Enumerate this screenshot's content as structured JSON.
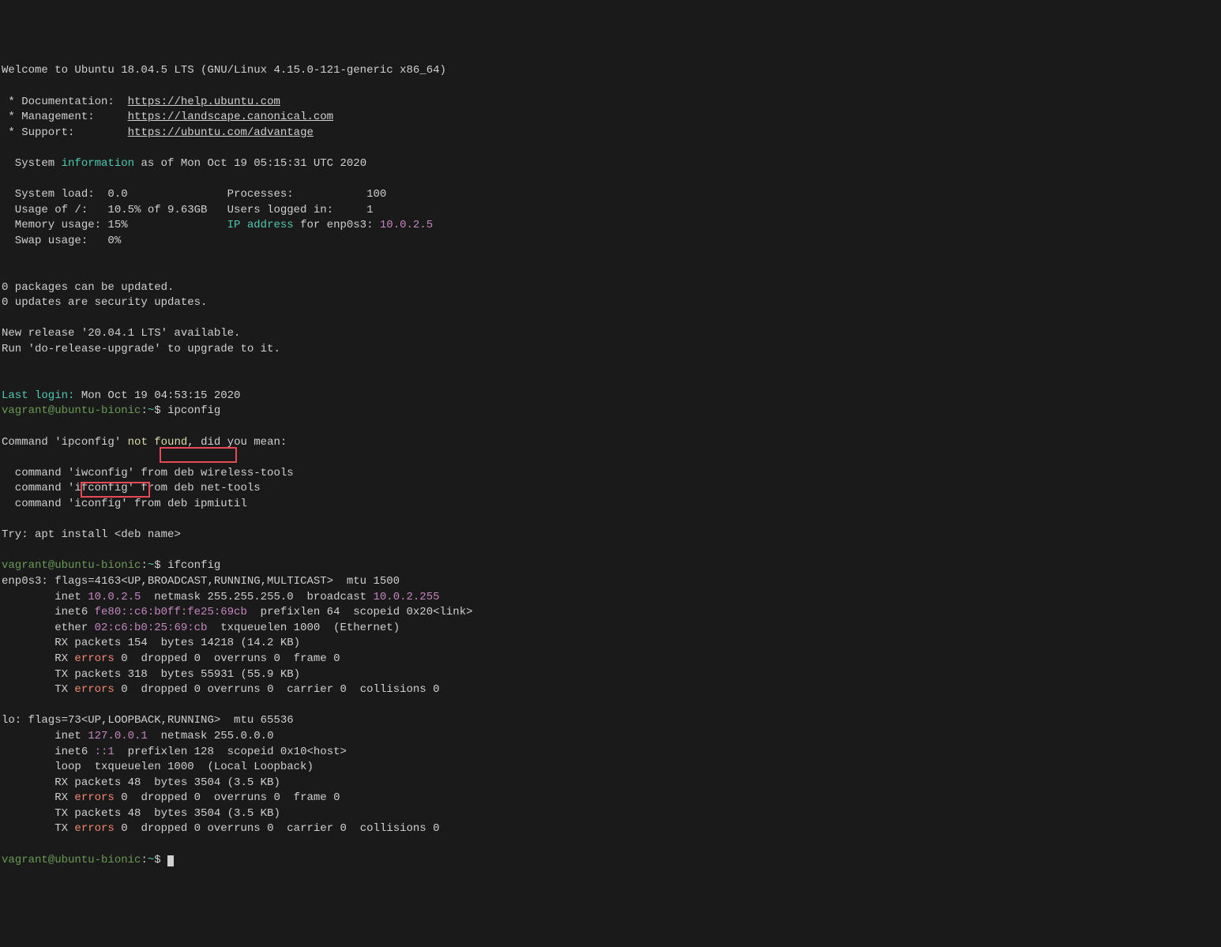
{
  "welcome": "Welcome to Ubuntu 18.04.5 LTS (GNU/Linux 4.15.0-121-generic x86_64)",
  "doc_label": " * Documentation:  ",
  "doc_url": "https://help.ubuntu.com",
  "mgmt_label": " * Management:     ",
  "mgmt_url": "https://landscape.canonical.com",
  "support_label": " * Support:        ",
  "support_url": "https://ubuntu.com/advantage",
  "sysinfo_prefix": "  System ",
  "sysinfo_info": "information",
  "sysinfo_suffix": " as of Mon Oct 19 05:15:31 UTC 2020",
  "sysload": "  System load:  0.0               Processes:           100",
  "usage": "  Usage of /:   10.5% of 9.63GB   Users logged in:     1",
  "memory_prefix": "  Memory usage: 15%               ",
  "ip_label": "IP address",
  "ip_for": " for enp0s3: ",
  "ip_value": "10.0.2.5",
  "swap": "  Swap usage:   0%",
  "packages": "0 packages can be updated.",
  "updates": "0 updates are security updates.",
  "release1": "New release '20.04.1 LTS' available.",
  "release2": "Run 'do-release-upgrade' to upgrade to it.",
  "lastlogin_label": "Last login:",
  "lastlogin_value": " Mon Oct 19 04:53:15 2020",
  "prompt1_user": "vagrant@ubuntu-bionic",
  "prompt1_colon": ":",
  "prompt1_path": "~",
  "prompt1_dollar": "$ ",
  "cmd_ipconfig": "ipconfig",
  "err_prefix": "Command 'ipconfig' ",
  "err_notfound": "not found",
  "err_suffix": ", did you mean:",
  "suggest1": "  command 'iwconfig' from deb wireless-tools",
  "suggest2": "  command 'ifconfig' from deb net-tools",
  "suggest3": "  command 'iconfig' from deb ipmiutil",
  "try_prefix": "Try: apt install ",
  "try_deb": "<deb name>",
  "cmd_ifconfig": "ifconfig",
  "if1_line1_a": "enp0s3: flags=4163<UP,BROADCAST,RUNNING,MULTICAST>  mtu 1500",
  "if1_line2_a": "        inet ",
  "if1_inet": "10.0.2.5",
  "if1_line2_b": "  netmask 255.255.255.0  broadcast ",
  "if1_bcast": "10.0.2.255",
  "if1_line3_a": "        inet6 ",
  "if1_inet6": "fe80::c6:b0ff:fe25:69cb",
  "if1_line3_b": "  prefixlen 64  scopeid 0x20<link>",
  "if1_line4_a": "        ether ",
  "if1_ether": "02:c6:b0:25:69:cb",
  "if1_line4_b": "  txqueuelen 1000  (Ethernet)",
  "if1_line5": "        RX packets 154  bytes 14218 (14.2 KB)",
  "if1_line6_a": "        RX ",
  "if1_err": "errors",
  "if1_line6_b": " 0  dropped 0  overruns 0  frame 0",
  "if1_line7": "        TX packets 318  bytes 55931 (55.9 KB)",
  "if1_line8_a": "        TX ",
  "if1_line8_b": " 0  dropped 0 overruns 0  carrier 0  collisions 0",
  "lo_line1": "lo: flags=73<UP,LOOPBACK,RUNNING>  mtu 65536",
  "lo_line2_a": "        inet ",
  "lo_inet": "127.0.0.1",
  "lo_line2_b": "  netmask 255.0.0.0",
  "lo_line3_a": "        inet6 ",
  "lo_inet6": "::1",
  "lo_line3_b": "  prefixlen 128  scopeid 0x10<host>",
  "lo_line4": "        loop  txqueuelen 1000  (Local Loopback)",
  "lo_line5": "        RX packets 48  bytes 3504 (3.5 KB)",
  "lo_line6_b": " 0  dropped 0  overruns 0  frame 0",
  "lo_line7": "        TX packets 48  bytes 3504 (3.5 KB)",
  "lo_line8_b": " 0  dropped 0 overruns 0  carrier 0  collisions 0"
}
